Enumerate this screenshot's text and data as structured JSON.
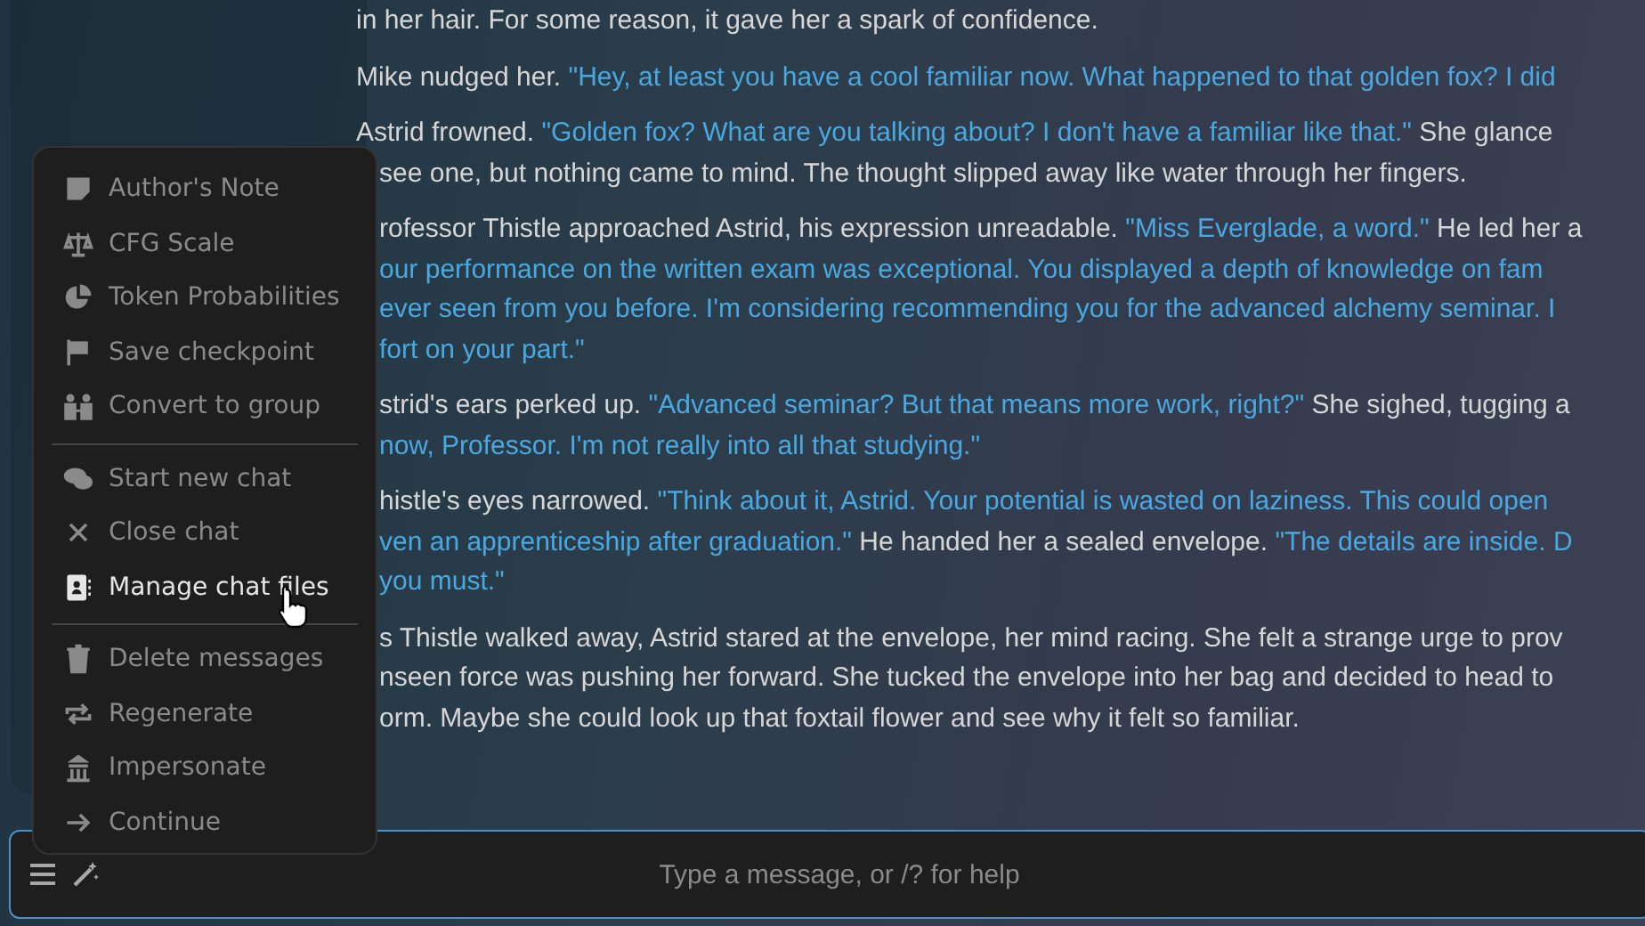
{
  "chat": {
    "paragraphs": [
      {
        "lines": [
          [
            {
              "kind": "narration",
              "text": "in her hair. For some reason, it gave her a spark of confidence."
            }
          ]
        ]
      },
      {
        "lines": [
          [
            {
              "kind": "narration",
              "text": "Mike nudged her. "
            },
            {
              "kind": "speech",
              "text": "\"Hey, at least you have a cool familiar now. What happened to that golden fox? I did"
            }
          ]
        ]
      },
      {
        "lines": [
          [
            {
              "kind": "narration",
              "text": "Astrid frowned. "
            },
            {
              "kind": "speech",
              "text": "\"Golden fox? What are you talking about? I don't have a familiar like that.\""
            },
            {
              "kind": "narration",
              "text": " She glance"
            }
          ],
          [
            {
              "kind": "narration",
              "text": "see one, but nothing came to mind. The thought slipped away like water through her fingers."
            }
          ]
        ]
      },
      {
        "lines": [
          [
            {
              "kind": "narration",
              "text": "rofessor Thistle approached Astrid, his expression unreadable. "
            },
            {
              "kind": "speech",
              "text": "\"Miss Everglade, a word.\""
            },
            {
              "kind": "narration",
              "text": " He led her a"
            }
          ],
          [
            {
              "kind": "speech",
              "text": "our performance on the written exam was exceptional. You displayed a depth of knowledge on fam"
            }
          ],
          [
            {
              "kind": "speech",
              "text": "ever seen from you before. I'm considering recommending you for the advanced alchemy seminar. I"
            }
          ],
          [
            {
              "kind": "speech",
              "text": "fort on your part.\""
            }
          ]
        ]
      },
      {
        "lines": [
          [
            {
              "kind": "narration",
              "text": "strid's ears perked up. "
            },
            {
              "kind": "speech",
              "text": "\"Advanced seminar? But that means more work, right?\""
            },
            {
              "kind": "narration",
              "text": " She sighed, tugging a"
            }
          ],
          [
            {
              "kind": "speech",
              "text": "now, Professor. I'm not really into all that studying.\""
            }
          ]
        ]
      },
      {
        "lines": [
          [
            {
              "kind": "narration",
              "text": "histle's eyes narrowed. "
            },
            {
              "kind": "speech",
              "text": "\"Think about it, Astrid. Your potential is wasted on laziness. This could open"
            }
          ],
          [
            {
              "kind": "speech",
              "text": "ven an apprenticeship after graduation.\""
            },
            {
              "kind": "narration",
              "text": " He handed her a sealed envelope. "
            },
            {
              "kind": "speech",
              "text": "\"The details are inside. D"
            }
          ],
          [
            {
              "kind": "speech",
              "text": "you must.\""
            }
          ]
        ]
      },
      {
        "lines": [
          [
            {
              "kind": "narration",
              "text": "s Thistle walked away, Astrid stared at the envelope, her mind racing. She felt a strange urge to prov"
            }
          ],
          [
            {
              "kind": "narration",
              "text": "nseen force was pushing her forward. She tucked the envelope into her bag and decided to head to"
            }
          ],
          [
            {
              "kind": "narration",
              "text": "orm. Maybe she could look up that foxtail flower and see why it felt so familiar."
            }
          ]
        ]
      }
    ]
  },
  "menu": {
    "groups": [
      [
        {
          "label": "Author's Note",
          "highlighted": false
        },
        {
          "label": "CFG Scale",
          "highlighted": false
        },
        {
          "label": "Token Probabilities",
          "highlighted": false
        },
        {
          "label": "Save checkpoint",
          "highlighted": false
        },
        {
          "label": "Convert to group",
          "highlighted": false
        }
      ],
      [
        {
          "label": "Start new chat",
          "highlighted": false
        },
        {
          "label": "Close chat",
          "highlighted": false
        },
        {
          "label": "Manage chat files",
          "highlighted": true
        }
      ],
      [
        {
          "label": "Delete messages",
          "highlighted": false
        },
        {
          "label": "Regenerate",
          "highlighted": false
        },
        {
          "label": "Impersonate",
          "highlighted": false
        },
        {
          "label": "Continue",
          "highlighted": false
        }
      ]
    ]
  },
  "input": {
    "placeholder": "Type a message, or /? for help"
  }
}
